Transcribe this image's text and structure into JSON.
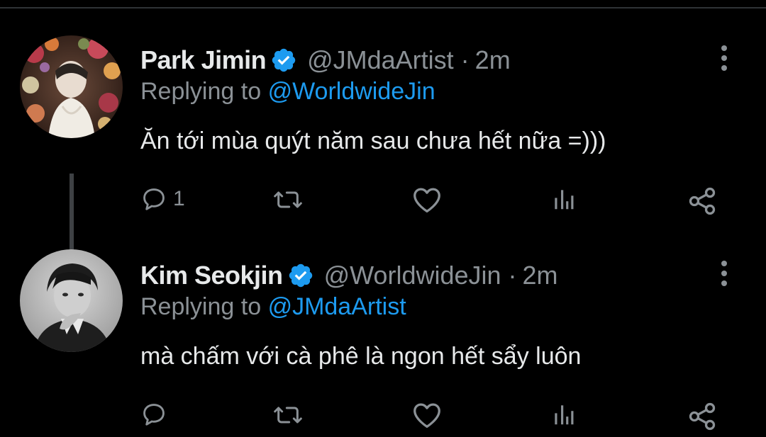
{
  "colors": {
    "background": "#000000",
    "text": "#e7e9ea",
    "muted": "#8b9196",
    "link": "#1d9bf0",
    "verified": "#1d9bf0"
  },
  "tweets": [
    {
      "display_name": "Park Jimin",
      "verified_icon": "verified-badge-icon",
      "handle": "@JMdaArtist",
      "separator": "·",
      "time": "2m",
      "replying_prefix": "Replying to",
      "replying_to": "@WorldwideJin",
      "text": "Ăn tới mùa quýt năm sau chưa hết nữa =)))",
      "reply_count": "1"
    },
    {
      "display_name": "Kim Seokjin",
      "verified_icon": "verified-badge-icon",
      "handle": "@WorldwideJin",
      "separator": "·",
      "time": "2m",
      "replying_prefix": "Replying to",
      "replying_to": "@JMdaArtist",
      "text": "mà chấm với cà phê là ngon hết sẩy luôn",
      "reply_count": ""
    }
  ]
}
